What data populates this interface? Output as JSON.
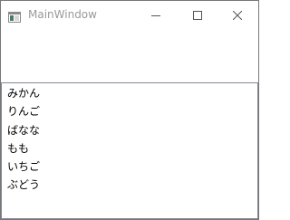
{
  "window": {
    "title": "MainWindow",
    "title_color": "#999999",
    "border_color": "#777777",
    "icons": {
      "app": "window-app-icon",
      "minimize": "minimize-icon",
      "maximize": "maximize-icon",
      "close": "close-icon"
    }
  },
  "listbox": {
    "border_color": "#828790",
    "items": [
      {
        "label": "みかん"
      },
      {
        "label": "りんご"
      },
      {
        "label": "ばなな"
      },
      {
        "label": "もも"
      },
      {
        "label": "いちご"
      },
      {
        "label": "ぶどう"
      }
    ]
  }
}
